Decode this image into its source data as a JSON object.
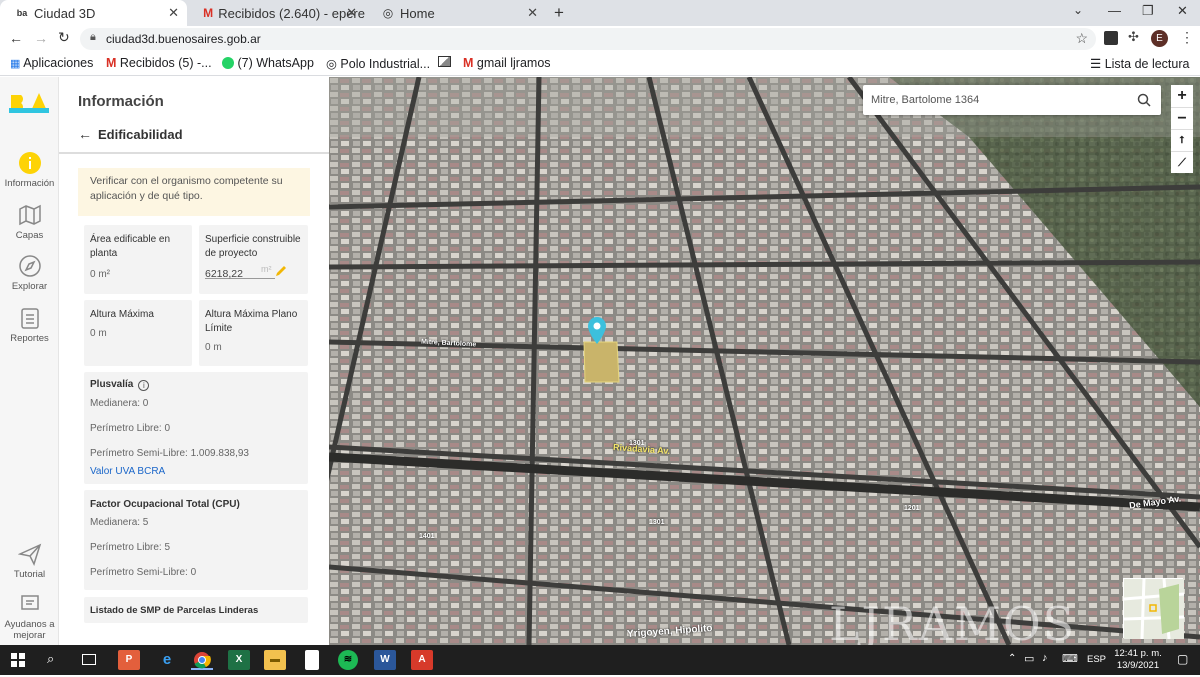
{
  "browser": {
    "tabs": [
      {
        "label": "Ciudad 3D",
        "icon": "ba-icon",
        "active": true
      },
      {
        "label": "Recibidos (2.640) - epere",
        "icon": "gmail-icon",
        "active": false
      },
      {
        "label": "Home",
        "icon": "globe-icon",
        "active": false
      }
    ],
    "new_tab": "+",
    "url": "ciudad3d.buenosaires.gob.ar",
    "profile_initial": "E",
    "bookmarks": [
      {
        "label": "Aplicaciones",
        "icon": "apps-grid-icon"
      },
      {
        "label": "Recibidos (5) -...",
        "icon": "gmail-icon"
      },
      {
        "label": "(7) WhatsApp",
        "icon": "whatsapp-icon"
      },
      {
        "label": "Polo Industrial...",
        "icon": "globe-icon"
      },
      {
        "label": "",
        "icon": "image-icon"
      },
      {
        "label": "gmail ljramos",
        "icon": "gmail-icon"
      }
    ],
    "reading_list": "Lista de lectura"
  },
  "rail": {
    "items": [
      {
        "label": "Información",
        "icon": "info-icon"
      },
      {
        "label": "Capas",
        "icon": "layers-icon"
      },
      {
        "label": "Explorar",
        "icon": "compass-icon"
      },
      {
        "label": "Reportes",
        "icon": "clipboard-icon"
      },
      {
        "label": "Tutorial",
        "icon": "paper-plane-icon"
      },
      {
        "label": "Ayudanos a mejorar",
        "icon": "feedback-icon"
      }
    ]
  },
  "panel": {
    "title": "Información",
    "back_label": "Edificabilidad",
    "notice": "Verificar con el organismo competente su aplicación y de qué tipo.",
    "area_edificable": {
      "label": "Área edificable en planta",
      "value": "0 m²"
    },
    "superficie": {
      "label": "Superficie construible de proyecto",
      "value": "6218,22",
      "unit": "m²"
    },
    "altura_maxima": {
      "label": "Altura Máxima",
      "value": "0 m"
    },
    "altura_plano": {
      "label": "Altura Máxima Plano Límite",
      "value": "0 m"
    },
    "plusvalia": {
      "title": "Plusvalía",
      "medianera": "Medianera: 0",
      "perimetro_libre": "Perímetro Libre: 0",
      "perimetro_semi": "Perímetro Semi-Libre: 1.009.838,93",
      "link": "Valor UVA BCRA"
    },
    "fot": {
      "title": "Factor Ocupacional Total (CPU)",
      "medianera": "Medianera: 5",
      "perimetro_libre": "Perímetro Libre: 5",
      "perimetro_semi": "Perímetro Semi-Libre: 0"
    },
    "listado": "Listado de SMP de Parcelas Linderas"
  },
  "map": {
    "search_value": "Mitre, Bartolome 1364",
    "zoom_in": "+",
    "zoom_out": "−",
    "streets": {
      "rivadavia": "Rivadavia Av.",
      "mitre": "Mitre, Bartolome",
      "yrigoyen": "Yrigoyen, Hipolito",
      "de_mayo": "De Mayo Av.",
      "n1301a": "1301",
      "n1301b": "1301",
      "n1401": "1401",
      "n1201": "1201"
    },
    "watermark": "LJRAMOS"
  },
  "taskbar": {
    "language": "ESP",
    "time": "12:41 p. m.",
    "date": "13/9/2021"
  },
  "colors": {
    "brand_yellow": "#fdd306",
    "brand_cyan": "#2fc5e0",
    "link_blue": "#1a66c9",
    "notice_bg": "#fdf6e2"
  }
}
